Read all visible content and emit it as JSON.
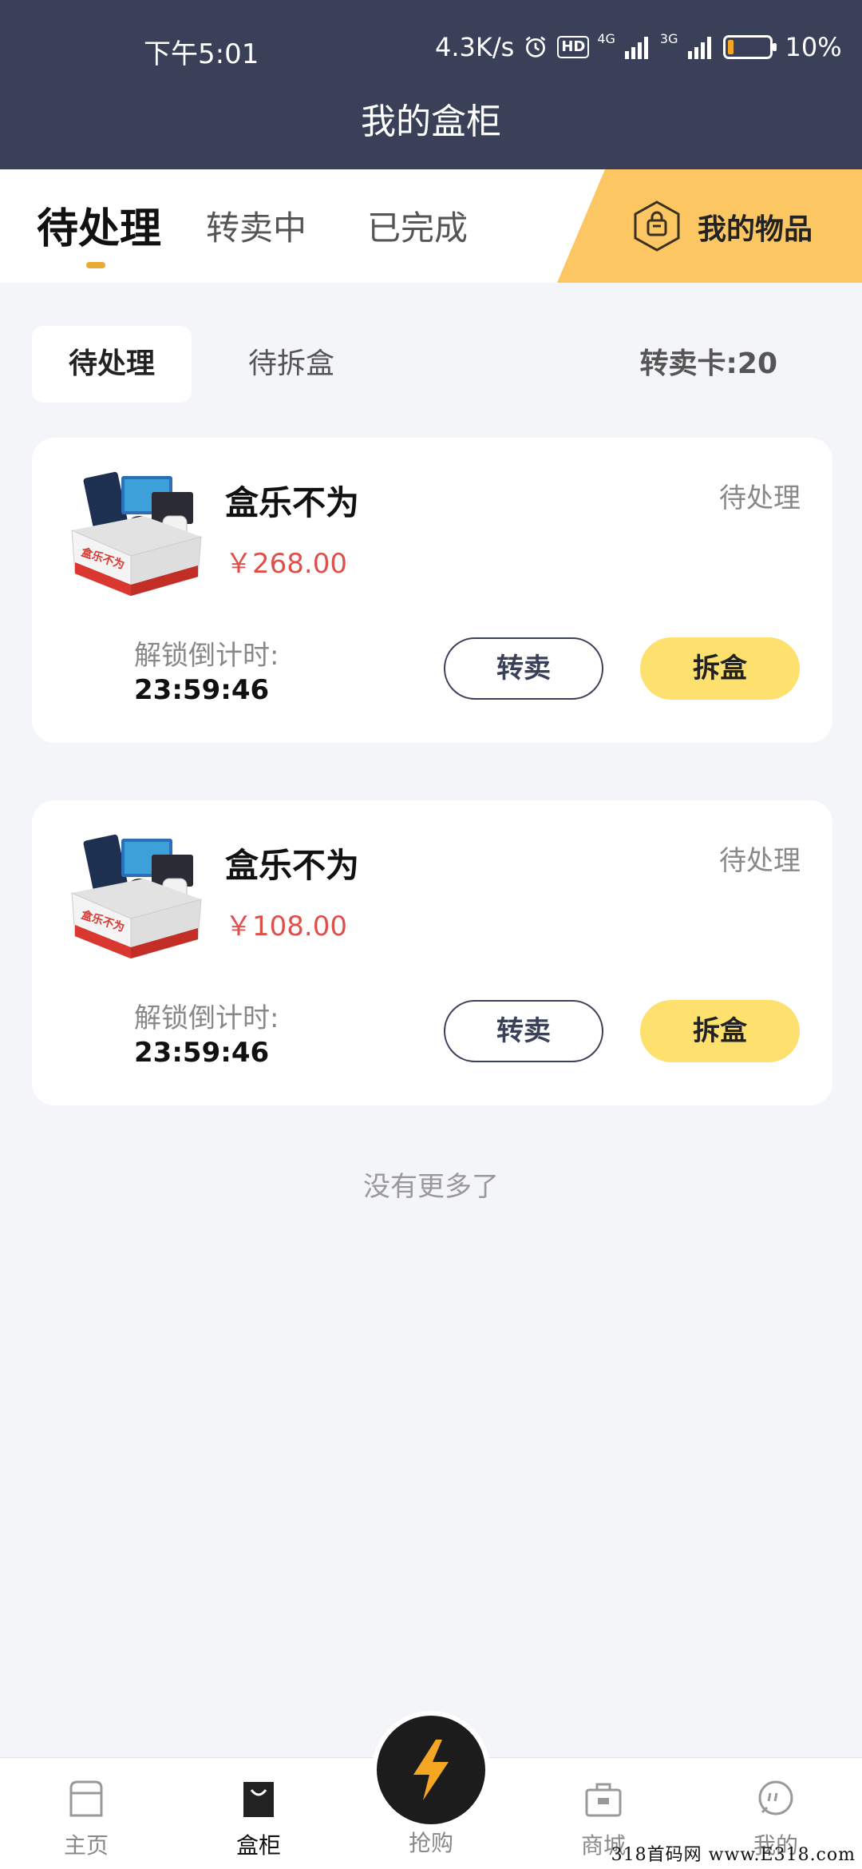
{
  "status_bar": {
    "time": "下午5:01",
    "net_speed": "4.3K/s",
    "hd": "HD",
    "net1": "4G",
    "net2": "3G",
    "battery": "10%",
    "battery_level": 0.1
  },
  "header": {
    "title": "我的盒柜"
  },
  "tabs": [
    {
      "label": "待处理",
      "active": true
    },
    {
      "label": "转卖中",
      "active": false
    },
    {
      "label": "已完成",
      "active": false
    }
  ],
  "my_items": {
    "label": "我的物品"
  },
  "sub_tabs": [
    {
      "label": "待处理",
      "active": true
    },
    {
      "label": "待拆盒",
      "active": false
    }
  ],
  "resale_card": "转卖卡:20",
  "cards": [
    {
      "name": "盒乐不为",
      "price": "￥268.00",
      "status": "待处理",
      "countdown_label": "解锁倒计时:",
      "countdown": "23:59:46",
      "resell_label": "转卖",
      "open_label": "拆盒"
    },
    {
      "name": "盒乐不为",
      "price": "￥108.00",
      "status": "待处理",
      "countdown_label": "解锁倒计时:",
      "countdown": "23:59:46",
      "resell_label": "转卖",
      "open_label": "拆盒"
    }
  ],
  "box_art_text": "盒乐不为",
  "no_more": "没有更多了",
  "bottom_nav": [
    {
      "label": "主页",
      "icon": "home-icon",
      "active": false
    },
    {
      "label": "盒柜",
      "icon": "bag-icon",
      "active": true
    },
    {
      "label": "抢购",
      "icon": "lightning-icon",
      "active": false
    },
    {
      "label": "商城",
      "icon": "shop-icon",
      "active": false
    },
    {
      "label": "我的",
      "icon": "profile-icon",
      "active": false
    }
  ],
  "watermark": "318首码网 www.E318.com",
  "colors": {
    "header_bg": "#3a4058",
    "accent_yellow": "#fcc762",
    "button_yellow": "#fde06e",
    "price_red": "#e0504a",
    "tab_indicator": "#e8a935"
  }
}
